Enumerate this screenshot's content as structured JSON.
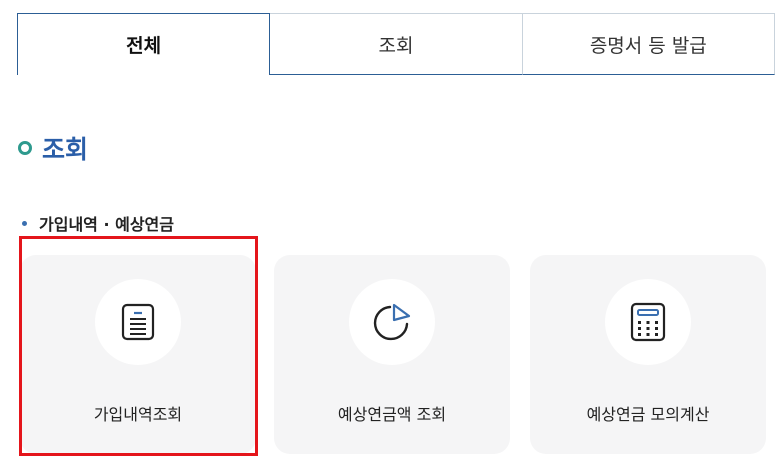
{
  "tabs": [
    {
      "label": "전체"
    },
    {
      "label": "조회"
    },
    {
      "label": "증명서 등 발급"
    }
  ],
  "section": {
    "title": "조회"
  },
  "group": {
    "title": "가입내역 · 예상연금"
  },
  "cards": [
    {
      "label": "가입내역조회",
      "icon": "document-list-icon"
    },
    {
      "label": "예상연금액 조회",
      "icon": "pie-chart-icon"
    },
    {
      "label": "예상연금 모의계산",
      "icon": "calculator-icon"
    }
  ],
  "colors": {
    "accent": "#2a5ea8",
    "tab_border": "#2c5e95",
    "highlight": "#e4151b",
    "ring": "#2e9a8e"
  }
}
